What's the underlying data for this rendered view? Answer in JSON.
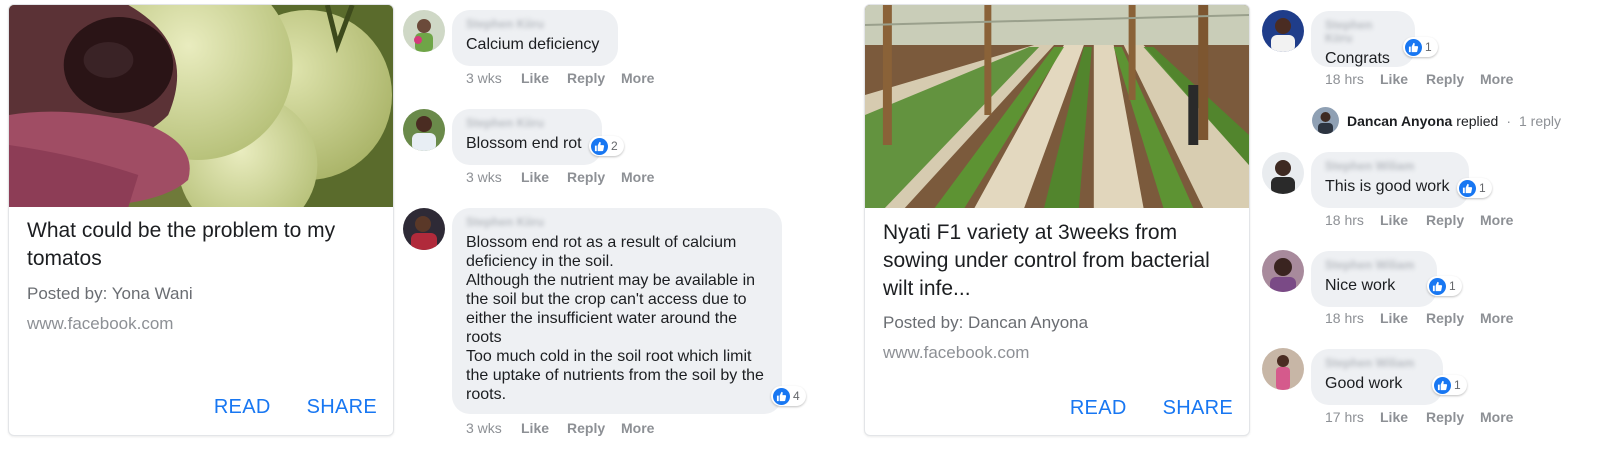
{
  "posts": [
    {
      "title": "What could be the problem to my tomatos",
      "posted_by": "Posted by: Yona Wani",
      "domain": "www.facebook.com",
      "read_label": "READ",
      "share_label": "SHARE"
    },
    {
      "title": "Nyati F1 variety at 3weeks from sowing under control from bacterial wilt infe...",
      "posted_by": "Posted by: Dancan Anyona",
      "domain": "www.facebook.com",
      "read_label": "READ",
      "share_label": "SHARE"
    }
  ],
  "comments_left": [
    {
      "author": "Stephen Kiiru",
      "text": "Calcium deficiency",
      "time": "3 wks",
      "reactions": ""
    },
    {
      "author": "Stephen Kiiru",
      "text": "Blossom end rot",
      "time": "3 wks",
      "reactions": "2"
    },
    {
      "author": "Stephen Kiiru",
      "text": "Blossom end rot as a result of calcium deficiency in the soil.\nAlthough the nutrient may be available in the soil but the crop can't access due to either the insufficient water around the roots\nToo much cold in the soil root which limit the uptake of nutrients from the soil by the roots.",
      "time": "3 wks",
      "reactions": "4"
    }
  ],
  "comments_right": [
    {
      "author": "Stephen Kiiru",
      "text": "Congrats",
      "time": "18 hrs",
      "reactions": "1"
    },
    {
      "author": "Stephen Wiliam",
      "text": "This is good work",
      "time": "18 hrs",
      "reactions": "1"
    },
    {
      "author": "Stephen Wiliam",
      "text": "Nice work",
      "time": "18 hrs",
      "reactions": "1"
    },
    {
      "author": "Stephen Wiliam",
      "text": "Good work",
      "time": "17 hrs",
      "reactions": "1"
    }
  ],
  "replied": {
    "name": "Dancan Anyona",
    "verb": "replied",
    "sep": "·",
    "count": "1 reply"
  },
  "actions": {
    "like": "Like",
    "reply": "Reply",
    "more": "More"
  },
  "icons": {
    "like_badge": "thumbs-up-icon",
    "accent": "#1877f2"
  }
}
